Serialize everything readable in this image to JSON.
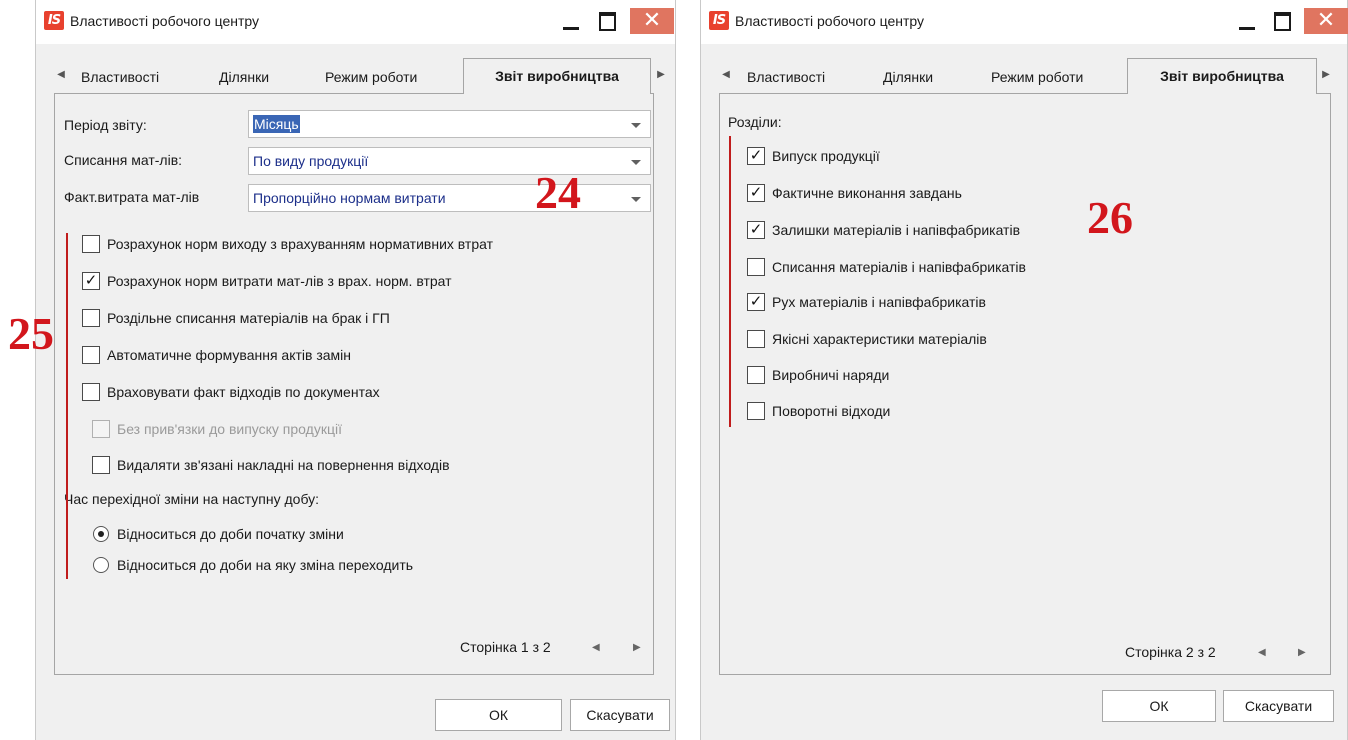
{
  "colors": {
    "accent": "#3a66b5",
    "annotation": "#d2161c",
    "close_button": "#e07560"
  },
  "annotations": {
    "a24": "24",
    "a25": "25",
    "a26": "26"
  },
  "left_window": {
    "title": "Властивості робочого центру",
    "logo": "IS",
    "close_glyph": "✕",
    "tabs": [
      "Властивості",
      "Ділянки",
      "Режим роботи",
      "Звіт виробництва"
    ],
    "active_tab": "Звіт виробництва",
    "fields": [
      {
        "label": "Період звіту:",
        "value": "Місяць"
      },
      {
        "label": "Списання мат-лів:",
        "value": "По виду продукції"
      },
      {
        "label": "Факт.витрата мат-лів",
        "value": "Пропорційно нормам витрати"
      }
    ],
    "checkboxes": [
      {
        "label": "Розрахунок норм виходу з врахуванням нормативних втрат",
        "checked": false
      },
      {
        "label": "Розрахунок норм витрати мат-лів з врах. норм. втрат",
        "checked": true
      },
      {
        "label": "Роздільне списання матеріалів на брак і ГП",
        "checked": false
      },
      {
        "label": "Автоматичне формування актів замін",
        "checked": false
      },
      {
        "label": "Враховувати факт відходів по документах",
        "checked": false
      },
      {
        "label": "Без прив'язки до випуску продукції",
        "checked": false,
        "disabled": true
      },
      {
        "label": "Видаляти зв'язані накладні на повернення відходів",
        "checked": false
      }
    ],
    "radio_group_label": "Час перехідної зміни  на наступну добу:",
    "radios": [
      {
        "label": "Відноситься до доби початку зміни",
        "selected": true
      },
      {
        "label": "Відноситься до доби на яку зміна переходить",
        "selected": false
      }
    ],
    "pager": "Сторінка 1 з 2",
    "ok_label": "ОК",
    "cancel_label": "Скасувати"
  },
  "right_window": {
    "title": "Властивості робочого центру",
    "logo": "IS",
    "close_glyph": "✕",
    "tabs": [
      "Властивості",
      "Ділянки",
      "Режим роботи",
      "Звіт виробництва"
    ],
    "active_tab": "Звіт виробництва",
    "sections_label": "Розділи:",
    "checkboxes": [
      {
        "label": "Випуск продукції",
        "checked": true
      },
      {
        "label": "Фактичне виконання завдань",
        "checked": true
      },
      {
        "label": "Залишки матеріалів і напівфабрикатів",
        "checked": true
      },
      {
        "label": "Списання матеріалів і напівфабрикатів",
        "checked": false
      },
      {
        "label": "Рух матеріалів і напівфабрикатів",
        "checked": true
      },
      {
        "label": "Якісні характеристики матеріалів",
        "checked": false
      },
      {
        "label": "Виробничі наряди",
        "checked": false
      },
      {
        "label": "Поворотні відходи",
        "checked": false
      }
    ],
    "pager": "Сторінка 2 з 2",
    "ok_label": "ОК",
    "cancel_label": "Скасувати"
  }
}
